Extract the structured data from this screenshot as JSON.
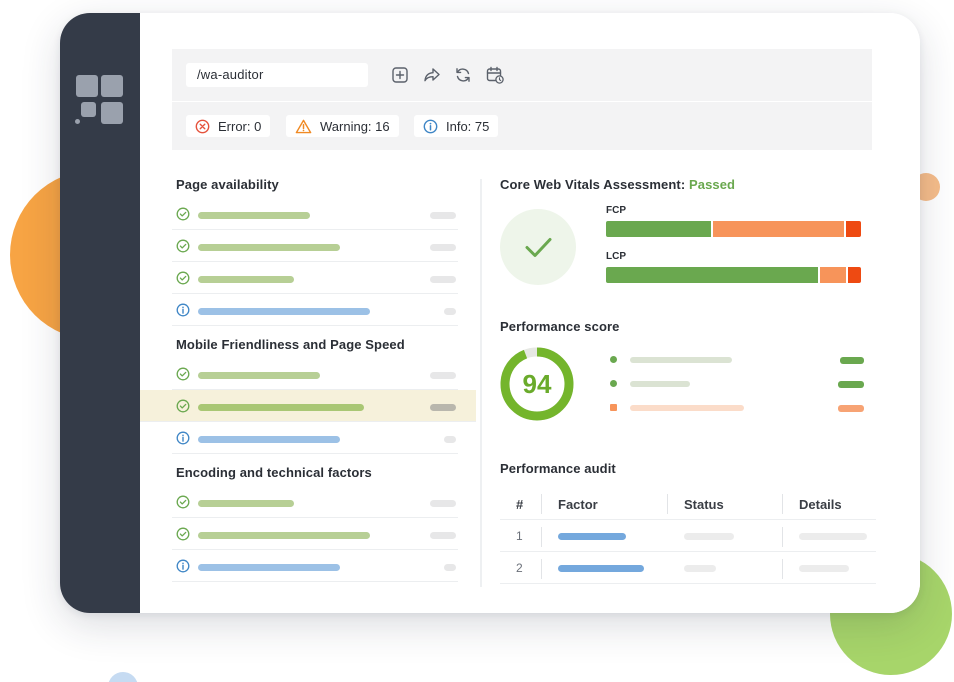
{
  "toolbar": {
    "url": "/wa-auditor",
    "icons": [
      "add-page-icon",
      "share-icon",
      "refresh-icon",
      "schedule-icon"
    ]
  },
  "status": {
    "error_label": "Error: 0",
    "warning_label": "Warning: 16",
    "info_label": "Info: 75"
  },
  "left": {
    "page_availability_title": "Page availability",
    "mobile_title": "Mobile Friendliness and Page Speed",
    "encoding_title": "Encoding and technical factors"
  },
  "cwv": {
    "title_prefix": "Core Web Vitals Assessment: ",
    "title_status": "Passed",
    "fcp_label": "FCP",
    "lcp_label": "LCP",
    "fcp_split": [
      0.42,
      0.52,
      0.06
    ],
    "lcp_split": [
      0.84,
      0.11,
      0.05
    ]
  },
  "performance": {
    "score_title": "Performance score",
    "score": "94",
    "score_fraction": 0.94
  },
  "audit": {
    "title": "Performance audit",
    "columns": [
      "#",
      "Factor",
      "Status",
      "Details"
    ],
    "rows": [
      "1",
      "2"
    ]
  },
  "colors": {
    "pass": "#6aa84f",
    "info": "#3f86c6",
    "warning": "#f08a24",
    "error": "#e5533d",
    "green_bar": "#b7cf95",
    "blue_bar": "#9cc1e6",
    "orange_bar": "#f7945a",
    "red_bar": "#ee4a12"
  }
}
